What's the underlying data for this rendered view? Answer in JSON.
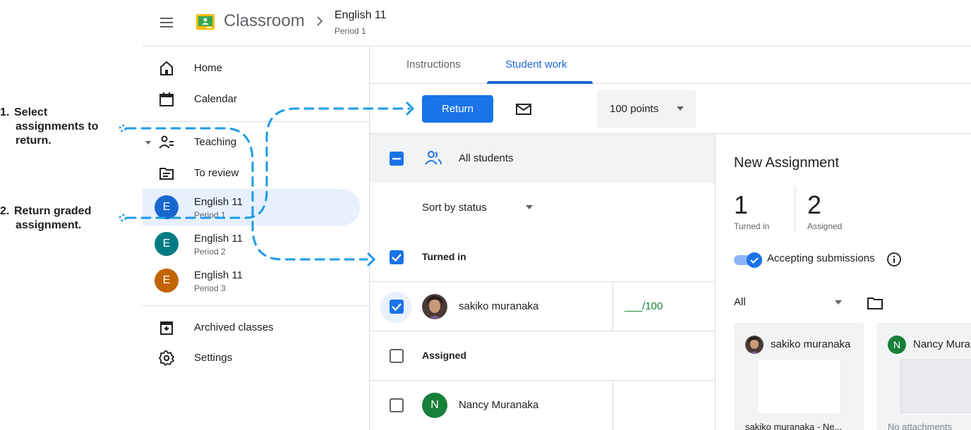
{
  "header": {
    "app_name": "Classroom",
    "breadcrumb_title": "English 11",
    "breadcrumb_subtitle": "Period 1"
  },
  "sidebar": {
    "home": "Home",
    "calendar": "Calendar",
    "teaching": "Teaching",
    "to_review": "To review",
    "classes": [
      {
        "initial": "E",
        "name": "English 11",
        "period": "Period 1",
        "color": "#1967d2"
      },
      {
        "initial": "E",
        "name": "English 11",
        "period": "Period 2",
        "color": "#007b83"
      },
      {
        "initial": "E",
        "name": "English 11",
        "period": "Period 3",
        "color": "#c26401"
      }
    ],
    "archived": "Archived classes",
    "settings": "Settings"
  },
  "tabs": {
    "instructions": "Instructions",
    "student_work": "Student work"
  },
  "toolbar": {
    "return_label": "Return",
    "points_value": "100 points"
  },
  "list": {
    "all_students": "All students",
    "sort_label": "Sort by status",
    "turned_in_heading": "Turned in",
    "assigned_heading": "Assigned",
    "students": [
      {
        "name": "sakiko muranaka",
        "grade": "___/100",
        "checked": true
      },
      {
        "name": "Nancy Muranaka",
        "initial": "N",
        "grade": "",
        "checked": false
      }
    ]
  },
  "panel": {
    "title": "New Assignment",
    "turned_in_count": "1",
    "turned_in_label": "Turned in",
    "assigned_count": "2",
    "assigned_label": "Assigned",
    "accepting_label": "Accepting submissions",
    "filter_value": "All",
    "cards": [
      {
        "name": "sakiko muranaka",
        "footer": "sakiko muranaka - Ne..."
      },
      {
        "name": "Nancy Muranaka",
        "initial": "N",
        "footer": "No attachments"
      }
    ]
  },
  "annotations": {
    "step1_number": "1.",
    "step1_line1": "Select",
    "step1_line2": "assignments to",
    "step1_line3": "return.",
    "step2_number": "2.",
    "step2_line1": "Return graded",
    "step2_line2": "assignment."
  },
  "colors": {
    "accent": "#1a73e8",
    "annotation": "#1a9be8"
  }
}
